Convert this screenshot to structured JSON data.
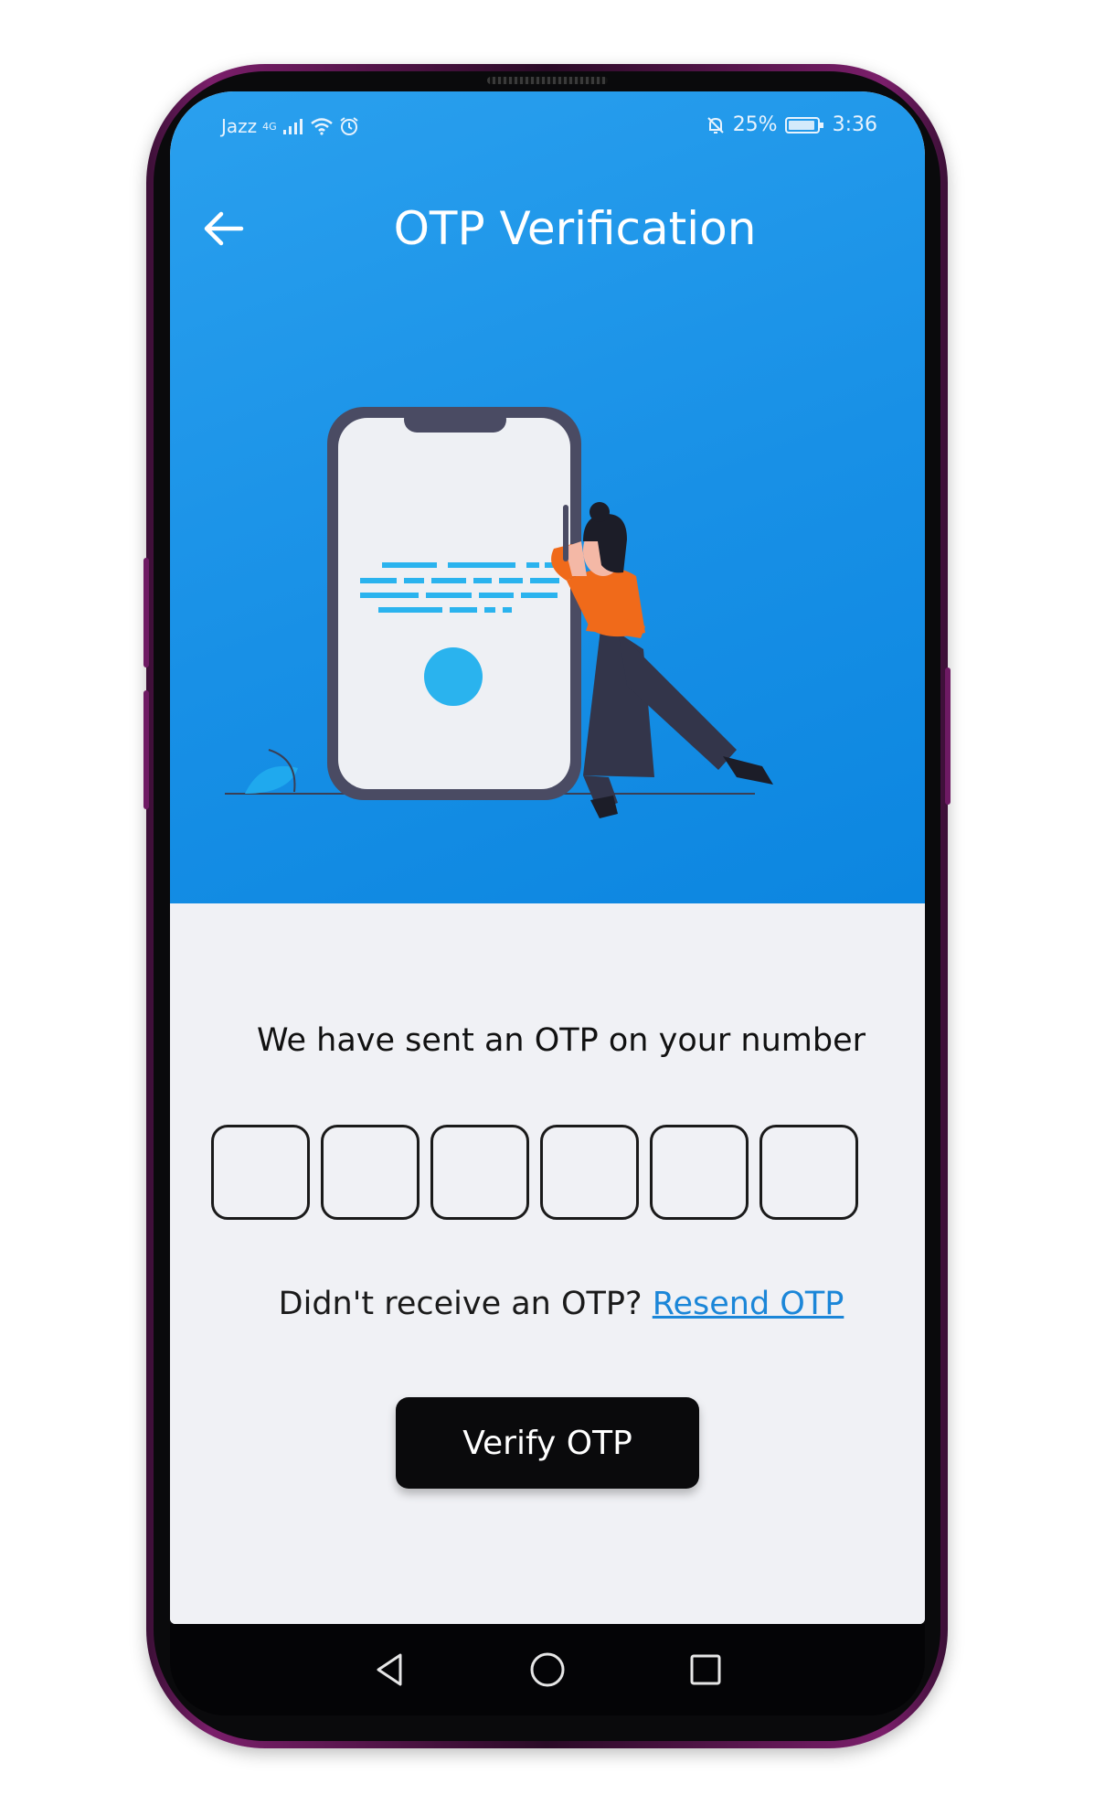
{
  "status_bar": {
    "carrier": "Jazz",
    "network": "4G",
    "battery": "25%",
    "time": "3:36"
  },
  "header": {
    "title": "OTP Verification"
  },
  "otp": {
    "message": "We have sent an OTP on your number",
    "digits": [
      "",
      "",
      "",
      "",
      "",
      ""
    ]
  },
  "resend": {
    "prompt": "Didn't receive an OTP?",
    "link_label": "Resend OTP"
  },
  "verify_button": {
    "label": "Verify OTP"
  },
  "colors": {
    "hero_blue": "#1890e6",
    "link_blue": "#1b86d8",
    "button_black": "#0a0a0c",
    "shirt_orange": "#f06a1a",
    "content_bg": "#f0f1f5"
  },
  "icons": {
    "back": "arrow-left-icon",
    "nav_back": "triangle-back-icon",
    "nav_home": "circle-home-icon",
    "nav_recents": "square-recents-icon"
  }
}
